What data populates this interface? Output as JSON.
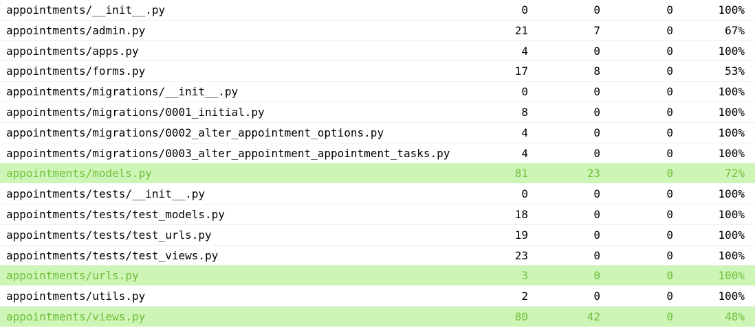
{
  "rows": [
    {
      "name": "appointments/__init__.py",
      "stmts": "0",
      "miss": "0",
      "excluded": "0",
      "coverage": "100%",
      "highlight": false
    },
    {
      "name": "appointments/admin.py",
      "stmts": "21",
      "miss": "7",
      "excluded": "0",
      "coverage": "67%",
      "highlight": false
    },
    {
      "name": "appointments/apps.py",
      "stmts": "4",
      "miss": "0",
      "excluded": "0",
      "coverage": "100%",
      "highlight": false
    },
    {
      "name": "appointments/forms.py",
      "stmts": "17",
      "miss": "8",
      "excluded": "0",
      "coverage": "53%",
      "highlight": false
    },
    {
      "name": "appointments/migrations/__init__.py",
      "stmts": "0",
      "miss": "0",
      "excluded": "0",
      "coverage": "100%",
      "highlight": false
    },
    {
      "name": "appointments/migrations/0001_initial.py",
      "stmts": "8",
      "miss": "0",
      "excluded": "0",
      "coverage": "100%",
      "highlight": false
    },
    {
      "name": "appointments/migrations/0002_alter_appointment_options.py",
      "stmts": "4",
      "miss": "0",
      "excluded": "0",
      "coverage": "100%",
      "highlight": false
    },
    {
      "name": "appointments/migrations/0003_alter_appointment_appointment_tasks.py",
      "stmts": "4",
      "miss": "0",
      "excluded": "0",
      "coverage": "100%",
      "highlight": false
    },
    {
      "name": "appointments/models.py",
      "stmts": "81",
      "miss": "23",
      "excluded": "0",
      "coverage": "72%",
      "highlight": true
    },
    {
      "name": "appointments/tests/__init__.py",
      "stmts": "0",
      "miss": "0",
      "excluded": "0",
      "coverage": "100%",
      "highlight": false
    },
    {
      "name": "appointments/tests/test_models.py",
      "stmts": "18",
      "miss": "0",
      "excluded": "0",
      "coverage": "100%",
      "highlight": false
    },
    {
      "name": "appointments/tests/test_urls.py",
      "stmts": "19",
      "miss": "0",
      "excluded": "0",
      "coverage": "100%",
      "highlight": false
    },
    {
      "name": "appointments/tests/test_views.py",
      "stmts": "23",
      "miss": "0",
      "excluded": "0",
      "coverage": "100%",
      "highlight": false
    },
    {
      "name": "appointments/urls.py",
      "stmts": "3",
      "miss": "0",
      "excluded": "0",
      "coverage": "100%",
      "highlight": true
    },
    {
      "name": "appointments/utils.py",
      "stmts": "2",
      "miss": "0",
      "excluded": "0",
      "coverage": "100%",
      "highlight": false
    },
    {
      "name": "appointments/views.py",
      "stmts": "80",
      "miss": "42",
      "excluded": "0",
      "coverage": "48%",
      "highlight": true
    }
  ],
  "colors": {
    "highlight_bg": "#cdf5b6",
    "highlight_text": "#6fbf3a",
    "row_border": "#eeeeee"
  }
}
